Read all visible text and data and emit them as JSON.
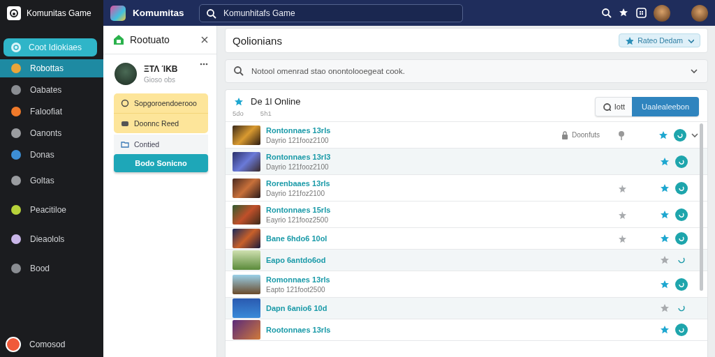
{
  "sidebar": {
    "brand": "Komunitas Game",
    "action": {
      "label": "Coot Idiokiaes"
    },
    "items": [
      {
        "label": "Robottas",
        "selected": true,
        "color": "#e8a53a"
      },
      {
        "label": "Oabates",
        "selected": false,
        "color": "#8a8d92"
      },
      {
        "label": "Faloofiat",
        "selected": false,
        "color": "#f07a2a"
      },
      {
        "label": "Oanonts",
        "selected": false,
        "color": "#9a9ca0"
      },
      {
        "label": "Donas",
        "selected": false,
        "color": "#3d8fd6"
      },
      {
        "label": "Goltas",
        "selected": false,
        "color": "#9a9ca0"
      },
      {
        "label": "Peacitiloe",
        "selected": false,
        "color": "#b7d23a"
      },
      {
        "label": "Dieaolols",
        "selected": false,
        "color": "#c9b6e8"
      },
      {
        "label": "Bood",
        "selected": false,
        "color": "#8a8d92"
      }
    ],
    "user": {
      "name": "Comosod"
    }
  },
  "topbar": {
    "title": "Komumitas",
    "search": {
      "value": "Komunhitafs Game"
    }
  },
  "panel": {
    "title": "Rootuato",
    "profile": {
      "name": "ΞΤΛ ΊΚΒ",
      "status": "Gioso obs"
    },
    "notices": [
      {
        "label": "Sopgoroendoerooo"
      },
      {
        "label": "Doonnc Reed"
      }
    ],
    "link": {
      "label": "Contied"
    },
    "button": {
      "label": "Bodo Sonicno"
    }
  },
  "content": {
    "header": {
      "title": "Qolionians",
      "filter": {
        "label": "Rateo Dedam"
      }
    },
    "search": {
      "placeholder": "Notool omenrad stao onontolooegeat cook."
    },
    "list": {
      "title": "De 1l Online",
      "meta": [
        "5do",
        "5h1"
      ],
      "find_button": {
        "label": "Iott"
      },
      "primary_button": {
        "label": "Uaalealeebon"
      },
      "rows": [
        {
          "title": "Rontonnaes 13rls",
          "subtitle": "Dayrio  121fooz2100",
          "highlighted": false,
          "rated": false,
          "starred": true,
          "joined": true,
          "lock_label": "Doonfuts",
          "expanded": false
        },
        {
          "title": "Rontonnaes 13rl3",
          "subtitle": "Dayrio  121fooz2100",
          "highlighted": true,
          "rated": false,
          "starred": true,
          "joined": true
        },
        {
          "title": "Rorenbaaes 13rls",
          "subtitle": "Dayrio  121foz2100",
          "highlighted": false,
          "rated": true,
          "starred": true,
          "joined": true
        },
        {
          "title": "Rontonnaes 15rls",
          "subtitle": "Eayrio  121fooz2500",
          "highlighted": false,
          "rated": true,
          "starred": true,
          "joined": true
        },
        {
          "title": "Bane 6hdo6 10ol",
          "highlighted": false,
          "rated": true,
          "starred": true,
          "joined": true
        },
        {
          "title": "Eapo 6antdo6od",
          "highlighted": true,
          "rated": false,
          "starred": false,
          "joined": false
        },
        {
          "title": "Romonnaes 13rls",
          "subtitle": "Eapto  121foot2500",
          "highlighted": false,
          "rated": false,
          "starred": true,
          "joined": true
        },
        {
          "title": "Dapn 6anio6 10d",
          "highlighted": true,
          "rated": false,
          "starred": false,
          "joined": false
        },
        {
          "title": "Rootonnaes 13rls",
          "highlighted": false,
          "rated": false,
          "starred": true,
          "joined": true
        }
      ]
    }
  }
}
